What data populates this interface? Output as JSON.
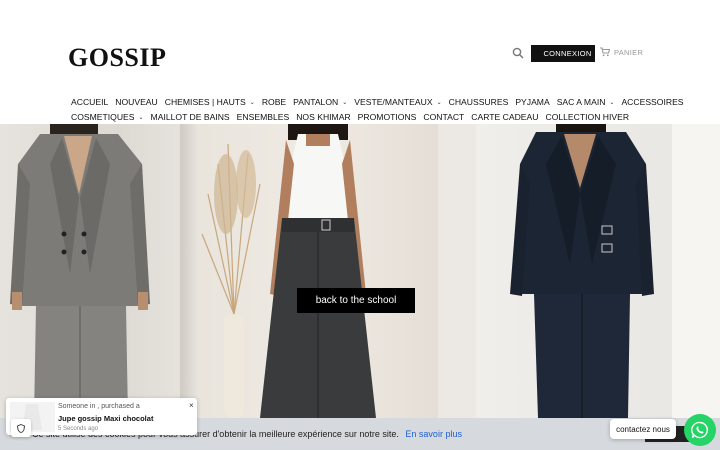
{
  "brand": {
    "logo": "GOSSIP"
  },
  "header": {
    "login_label": "CONNEXION",
    "cart_label": "PANIER"
  },
  "nav": {
    "row1": [
      "ACCUEIL",
      "NOUVEAU",
      "CHEMISES | HAUTS",
      "ROBE",
      "PANTALON",
      "VESTE/MANTEAUX",
      "CHAUSSURES",
      "PYJAMA",
      "SAC A MAIN",
      "ACCESSOIRES"
    ],
    "row1_dropdown": [
      false,
      false,
      true,
      false,
      true,
      true,
      false,
      false,
      true,
      false
    ],
    "row2": [
      "COSMETIQUES",
      "MAILLOT DE BAINS",
      "ENSEMBLES",
      "NOS KHIMAR",
      "PROMOTIONS",
      "CONTACT",
      "CARTE CADEAU",
      "COLLECTION HIVER"
    ],
    "row2_dropdown": [
      true,
      false,
      false,
      false,
      false,
      false,
      false,
      false
    ]
  },
  "hero": {
    "button_label": "back to the school"
  },
  "cookie": {
    "text": "Ce site utilise des cookies pour vous assurer d'obtenir la meilleure expérience sur notre site.",
    "link_label": "En savoir plus",
    "ok_label": "Ok"
  },
  "sales_popup": {
    "line1": "Someone in , purchased a",
    "product": "Jupe gossip Maxi chocolat",
    "time": "5 Seconds ago",
    "close": "×"
  },
  "contact": {
    "label": "contactez nous"
  },
  "colors": {
    "whatsapp": "#25d366",
    "link": "#1e5fd0",
    "button": "#000000"
  }
}
